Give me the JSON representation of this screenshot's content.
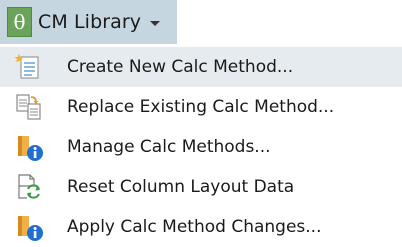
{
  "app": {
    "menu_button": {
      "logo_glyph": "θ",
      "title": "CM Library",
      "caret_icon": "chevron-down-icon"
    }
  },
  "menu": {
    "items": [
      {
        "label": "Create New Calc Method...",
        "icon": "new-document-icon",
        "highlighted": true
      },
      {
        "label": "Replace Existing Calc Method...",
        "icon": "replace-documents-icon",
        "highlighted": false
      },
      {
        "label": "Manage Calc Methods...",
        "icon": "manage-info-icon",
        "highlighted": false
      },
      {
        "label": "Reset Column Layout Data",
        "icon": "reset-refresh-icon",
        "highlighted": false
      },
      {
        "label": "Apply Calc Method Changes...",
        "icon": "apply-info-icon",
        "highlighted": false
      }
    ]
  },
  "colors": {
    "ribbon_bg": "#c5d6e0",
    "logo_green": "#6ba35a",
    "highlight_bg": "#e5ebee",
    "info_blue": "#1f6fd1",
    "orange": "#e69a2e"
  }
}
